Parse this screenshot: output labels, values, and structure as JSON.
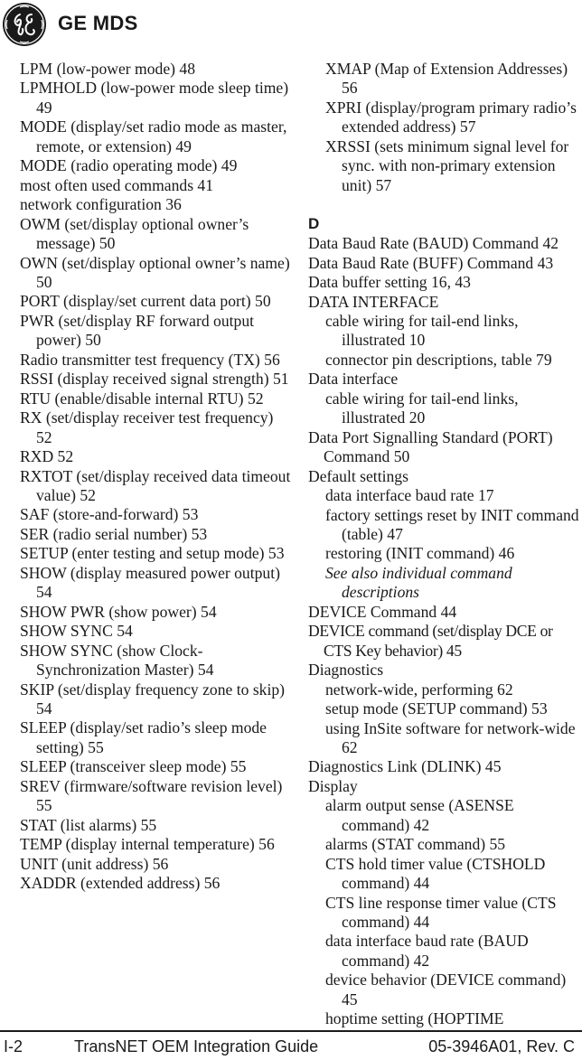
{
  "header": {
    "logo_icon": "ge-monogram-icon",
    "brand": "GE MDS"
  },
  "left_column": [
    {
      "level": 0,
      "text": "LPM (low-power mode)  48"
    },
    {
      "level": 0,
      "text": "LPMHOLD (low-power mode sleep time)  49"
    },
    {
      "level": 0,
      "text": "MODE (display/set radio mode as master, remote, or extension)  49"
    },
    {
      "level": 0,
      "text": "MODE (radio operating mode)  49"
    },
    {
      "level": 0,
      "text": "most often used commands  41"
    },
    {
      "level": 0,
      "text": "network configuration  36"
    },
    {
      "level": 0,
      "text": "OWM (set/display optional owner’s message)  50"
    },
    {
      "level": 0,
      "text": "OWN (set/display optional owner’s name)  50"
    },
    {
      "level": 0,
      "text": "PORT (display/set current data port)  50"
    },
    {
      "level": 0,
      "text": "PWR (set/display RF forward output power)  50"
    },
    {
      "level": 0,
      "text": "Radio transmitter test frequency (TX)  56"
    },
    {
      "level": 0,
      "text": "RSSI (display received signal strength)  51"
    },
    {
      "level": 0,
      "text": "RTU (enable/disable internal RTU)  52"
    },
    {
      "level": 0,
      "text": "RX (set/display receiver test frequency)  52"
    },
    {
      "level": 0,
      "text": "RXD  52"
    },
    {
      "level": 0,
      "text": "RXTOT (set/display received data timeout value)  52"
    },
    {
      "level": 0,
      "text": "SAF (store-and-forward)  53"
    },
    {
      "level": 0,
      "text": "SER (radio serial number)  53"
    },
    {
      "level": 0,
      "text": "SETUP (enter testing and setup mode)  53"
    },
    {
      "level": 0,
      "text": "SHOW (display measured power output)  54"
    },
    {
      "level": 0,
      "text": "SHOW PWR (show power)  54"
    },
    {
      "level": 0,
      "text": "SHOW SYNC  54"
    },
    {
      "level": 0,
      "text": "SHOW SYNC (show Clock-Synchronization Master)  54"
    },
    {
      "level": 0,
      "text": "SKIP (set/display frequency zone to skip)  54"
    },
    {
      "level": 0,
      "text": "SLEEP (display/set radio’s sleep mode setting)  55"
    },
    {
      "level": 0,
      "text": "SLEEP (transceiver sleep mode)  55"
    },
    {
      "level": 0,
      "text": "SREV (firmware/software revision level)  55"
    },
    {
      "level": 0,
      "text": "STAT (list alarms)  55"
    },
    {
      "level": 0,
      "text": "TEMP (display internal temperature)  56"
    },
    {
      "level": 0,
      "text": "UNIT (unit address)  56"
    },
    {
      "level": 0,
      "text": "XADDR (extended address)  56"
    }
  ],
  "right_column": {
    "continued": [
      {
        "level": 1,
        "text": "XMAP (Map of Extension Addresses)  56"
      },
      {
        "level": 1,
        "text": "XPRI (display/program primary radio’s extended address)  57"
      },
      {
        "level": 1,
        "text": "XRSSI (sets minimum signal level for sync. with non-primary extension unit)  57"
      }
    ],
    "section_letter": "D",
    "entries": [
      {
        "level": 0,
        "text": "Data Baud Rate (BAUD) Command  42"
      },
      {
        "level": 0,
        "text": "Data Baud Rate (BUFF) Command  43"
      },
      {
        "level": 0,
        "text": "Data buffer setting  16, 43"
      },
      {
        "level": 0,
        "text": "DATA INTERFACE"
      },
      {
        "level": 1,
        "text": "cable wiring for tail-end links, illustrated  10"
      },
      {
        "level": 1,
        "text": "connector pin descriptions, table  79"
      },
      {
        "level": 0,
        "text": "Data interface"
      },
      {
        "level": 1,
        "text": "cable wiring for tail-end links, illustrated  20"
      },
      {
        "level": 0,
        "text": "Data Port Signalling Standard (PORT) Command  50"
      },
      {
        "level": 0,
        "text": "Default settings"
      },
      {
        "level": 1,
        "text": "data interface baud rate  17"
      },
      {
        "level": 1,
        "text": "factory settings reset by INIT command (table)  47"
      },
      {
        "level": 1,
        "text": "restoring (INIT command)  46"
      },
      {
        "level": 1,
        "text": "See also individual command descriptions",
        "italic": true
      },
      {
        "level": 0,
        "text": "DEVICE Command  44"
      },
      {
        "level": 0,
        "text": "DEVICE command (set/display DCE or CTS Key behavior)  45",
        "narrow": true
      },
      {
        "level": 0,
        "text": "Diagnostics"
      },
      {
        "level": 1,
        "text": "network-wide, performing  62"
      },
      {
        "level": 1,
        "text": "setup mode (SETUP command)  53"
      },
      {
        "level": 1,
        "text": "using InSite software for network-wide  62"
      },
      {
        "level": 0,
        "text": "Diagnostics Link (DLINK)  45"
      },
      {
        "level": 0,
        "text": "Display"
      },
      {
        "level": 1,
        "text": "alarm output sense (ASENSE command)  42"
      },
      {
        "level": 1,
        "text": "alarms (STAT command)  55"
      },
      {
        "level": 1,
        "text": "CTS hold timer value (CTSHOLD command)  44"
      },
      {
        "level": 1,
        "text": "CTS line response timer value (CTS command)  44"
      },
      {
        "level": 1,
        "text": "data interface baud rate (BAUD command)  42"
      },
      {
        "level": 1,
        "text": "device behavior (DEVICE command)  45"
      },
      {
        "level": 1,
        "text": "hoptime setting (HOPTIME"
      }
    ]
  },
  "footer": {
    "page_number": "I-2",
    "title": "TransNET OEM Integration Guide",
    "doc_number": "05-3946A01, Rev. C"
  }
}
